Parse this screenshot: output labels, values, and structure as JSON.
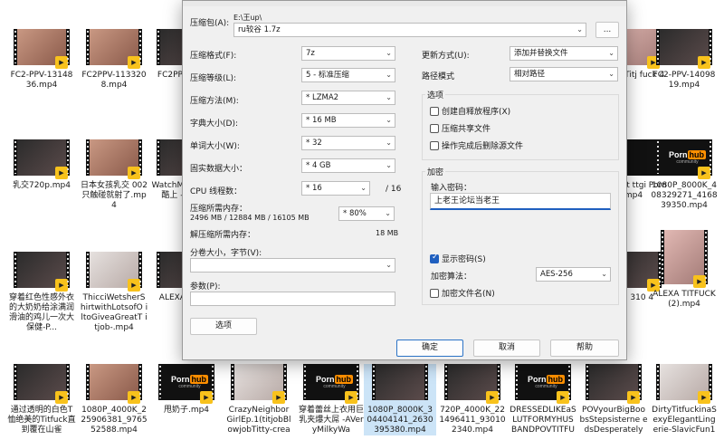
{
  "background_files": [
    {
      "name": "FC2-PPV-13148 36.mp4",
      "thumb": "skin"
    },
    {
      "name": "FC2PPV-113320 8.mp4",
      "thumb": "skin"
    },
    {
      "name": "FC2PPV 4.mp",
      "thumb": "dark"
    },
    {
      "name": "inyS -Titj fuck 4",
      "thumb": "pink"
    },
    {
      "name": "FC2-PPV-14098 19.mp4",
      "thumb": "dark"
    },
    {
      "name": "乳交720p.mp4",
      "thumb": "dark"
    },
    {
      "name": "日本女孩乳交 002 只触碰就射了.mp4",
      "thumb": "skin"
    },
    {
      "name": "WatchM 201804 酷上 -Paizur",
      "thumb": "dark"
    },
    {
      "name": "eMI ckt ttgi Porn mp4",
      "thumb": "ph"
    },
    {
      "name": "1080P_8000K_4 08329271_4168 39350.mp4",
      "thumb": "ph"
    },
    {
      "name": "穿着红色性感外衣的大奶奶给涂满润滑油的鸡儿一次大保健-P...",
      "thumb": "dark"
    },
    {
      "name": "ThicciWetsherS hirtwithLotsofO iltoGiveaGreatT itjob-.mp4",
      "thumb": "light"
    },
    {
      "name": "ALEXA (4).m",
      "thumb": "dark"
    },
    {
      "name": "P_4 310 4",
      "thumb": "dark"
    },
    {
      "name": "ALEXA TITFUCK (2).mp4",
      "thumb": "pink"
    },
    {
      "name": "通过透明的白色T恤绝美的Titfuck直到覆在山雀",
      "thumb": "dark"
    },
    {
      "name": "1080P_4000K_2 25906381_9765 52588.mp4",
      "thumb": "skin"
    },
    {
      "name": "甩奶子.mp4",
      "thumb": "ph"
    },
    {
      "name": "CrazyNeighbor GirlEp.1(titjobBl owjobTitty-crea",
      "thumb": "light"
    },
    {
      "name": "穿着蕾丝上衣用巨乳夹爆大屌 -AVeryMilkyWa",
      "thumb": "ph"
    },
    {
      "name": "1080P_8000K_3 04404141_2630 395380.mp4",
      "thumb": "dark"
    },
    {
      "name": "720P_4000K_22 1496411_93010 2340.mp4",
      "thumb": "dark"
    },
    {
      "name": "DRESSEDLIKEaS LUTFORMYHUS BANDPOVTITFU",
      "thumb": "ph"
    },
    {
      "name": "POVyourBigBoo bsStepsisterne edsDesperately",
      "thumb": "dark"
    },
    {
      "name": "DirtyTitfuckinaS exyElegantLing erie-SlavicFun1",
      "thumb": "light"
    }
  ],
  "ph_logo": {
    "porn": "Porn",
    "hub": "hub",
    "sub": "community"
  },
  "badge_glyph": "▶",
  "dialog": {
    "archive_label": "压缩包(A):",
    "archive_path": "E:\\王up\\",
    "archive_name": "ru较谷 1.7z",
    "browse_label": "...",
    "format_label": "压缩格式(F):",
    "format_value": "7z",
    "level_label": "压缩等级(L):",
    "level_value": "5 - 标准压缩",
    "method_label": "压缩方法(M):",
    "method_value": "* LZMA2",
    "dict_label": "字典大小(D):",
    "dict_value": "* 16 MB",
    "word_label": "单词大小(W):",
    "word_value": "* 32",
    "solid_label": "固实数据大小：",
    "solid_value": "* 4 GB",
    "threads_label": "CPU 线程数：",
    "threads_value": "* 16",
    "threads_max": "/ 16",
    "mem_compress_label": "压缩所需内存：",
    "mem_compress_values": "2496 MB / 12884 MB / 16105 MB",
    "mem_percent": "* 80%",
    "mem_decompress_label": "解压缩所需内存：",
    "mem_decompress_value": "18 MB",
    "split_label": "分卷大小，字节(V):",
    "split_value": "",
    "params_label": "参数(P):",
    "params_value": "",
    "options_button": "选项",
    "update_label": "更新方式(U):",
    "update_value": "添加并替换文件",
    "path_mode_label": "路径模式",
    "path_mode_value": "相对路径",
    "options_group": "选项",
    "opt_sfx": "创建自释放程序(X)",
    "opt_shared": "压缩共享文件",
    "opt_delete": "操作完成后删除源文件",
    "encrypt_group": "加密",
    "password_label": "输入密码：",
    "password_value": "上老王论坛当老王",
    "show_password": "显示密码(S)",
    "enc_method_label": "加密算法：",
    "enc_method_value": "AES-256",
    "encrypt_names": "加密文件名(N)",
    "ok_button": "确定",
    "cancel_button": "取消",
    "help_button": "帮助"
  }
}
